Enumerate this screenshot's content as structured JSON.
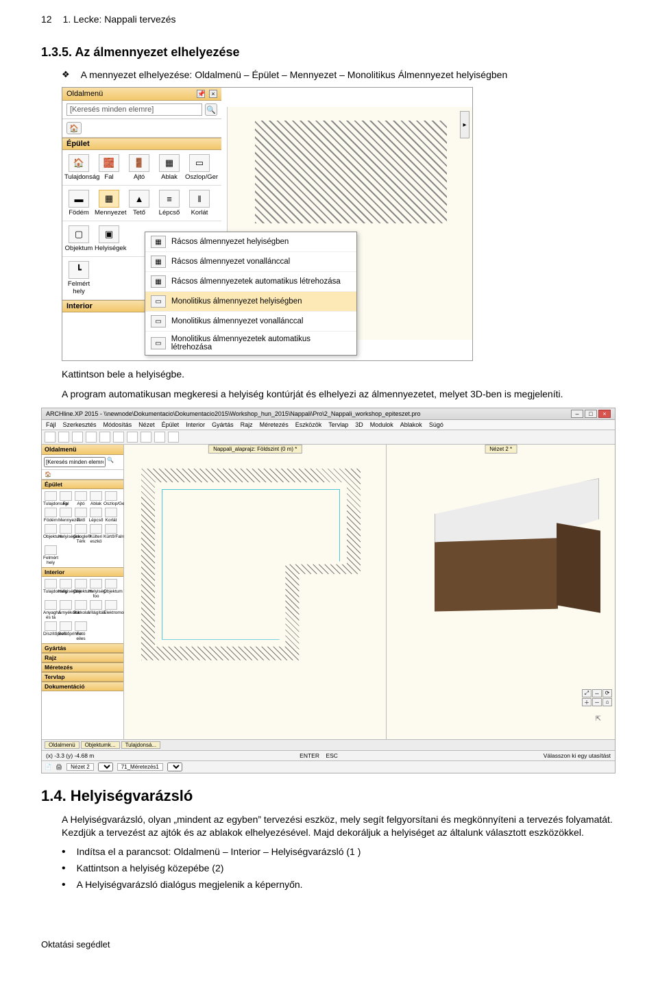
{
  "page": {
    "number": "12",
    "header_title": "1. Lecke: Nappali tervezés"
  },
  "sec135": {
    "heading": "1.3.5.  Az álmennyezet elhelyezése",
    "bullet1": "A mennyezet elhelyezése: Oldalmenü – Épület – Mennyezet – Monolitikus Álmennyezet helyiségben",
    "after_shot_line1": "Kattintson bele a helyiségbe.",
    "after_shot_line2": "A program automatikusan megkeresi a helyiség kontúrját és elhelyezi az álmennyezetet, melyet 3D-ben is megjeleníti."
  },
  "shot1": {
    "title": "Oldalmenü",
    "search_placeholder": "[Keresés minden elemre]",
    "cat_epulet": "Épület",
    "row1": [
      "Tulajdonság",
      "Fal",
      "Ajtó",
      "Ablak",
      "Oszlop/Ger"
    ],
    "row2": [
      "Födém",
      "Mennyezet",
      "Tető",
      "Lépcső",
      "Korlát"
    ],
    "row3": [
      "Objektum",
      "Helyiségek",
      "",
      "",
      ""
    ],
    "row4": [
      "Felmért hely",
      "",
      "",
      "",
      ""
    ],
    "cat_interior": "Interior",
    "flyout": [
      "Rácsos álmennyezet helyiségben",
      "Rácsos álmennyezet vonallánccal",
      "Rácsos álmennyezetek automatikus létrehozása",
      "Monolitikus álmennyezet helyiségben",
      "Monolitikus álmennyezet vonallánccal",
      "Monolitikus álmennyezetek automatikus létrehozása"
    ],
    "flyout_hover_index": 3
  },
  "shot2": {
    "window_title": "ARCHline.XP 2015 - \\\\newnode\\Dokumentacio\\Dokumentacio2015\\Workshop_hun_2015\\Nappali\\Pro\\2_Nappali_workshop_epiteszet.pro",
    "menubar": [
      "Fájl",
      "Szerkesztés",
      "Módosítás",
      "Nézet",
      "Épület",
      "Interior",
      "Gyártás",
      "Rajz",
      "Méretezés",
      "Eszközök",
      "Tervlap",
      "3D",
      "Modulok",
      "Ablakok",
      "Súgó"
    ],
    "sidebar_title": "Oldalmenü",
    "sidebar_search": "[Keresés minden elemre]",
    "sb_cats": {
      "epulet": "Épület",
      "epulet_items": [
        "Tulajdonság",
        "Fal",
        "Ajtó",
        "Ablak",
        "Oszlop/Ger",
        "Födém",
        "Mennyezet",
        "Tető",
        "Lépcső",
        "Korlát",
        "Objektum",
        "Helyiségek",
        "Google® Térk",
        "Külteri eszkö",
        "Kürtő/Falroh",
        "Felmért hely"
      ],
      "interior": "Interior",
      "interior_items": [
        "Tulajdonság",
        "Helyiségvar",
        "Objektum",
        "Helyiség foo",
        "Objektum",
        "Anyagha és tá",
        "Árnyékolók",
        "Burkolat",
        "Világítás",
        "Elektromos",
        "Díszítőprofil",
        "Belsőprihoz",
        "Fotó eiles"
      ],
      "gyartas": "Gyártás",
      "rajz": "Rajz",
      "meretezes": "Méretezés",
      "tervlap": "Tervlap",
      "dokumentacio": "Dokumentáció"
    },
    "view2d_title": "Nappali_alaprajz: Földszint (0 m) *",
    "view3d_title": "Nézet 2 *",
    "bottom_tabs": [
      "Oldalmenü",
      "Objektumk...",
      "Tulajdonsá..."
    ],
    "coord_text": "(x) -3.3   (y) -4.68 m",
    "enter_label": "ENTER",
    "esc_label": "ESC",
    "status_prompt": "Válasszon ki egy utasítást",
    "ruler_tab1": "Nézet 2",
    "ruler_tab2": "71_Méretezés1"
  },
  "sec14": {
    "heading": "1.4. Helyiségvarázsló",
    "para": "A Helyiségvarázsló, olyan „mindent az egyben” tervezési eszköz, mely segít felgyorsítani és megkönnyíteni a tervezés folyamatát. Kezdjük a tervezést az ajtók és az ablakok elhelyezésével. Majd dekoráljuk a helyiséget az általunk választott eszközökkel.",
    "b1": "Indítsa el a parancsot: Oldalmenü – Interior – Helyiségvarázsló (1 )",
    "b2": "Kattintson a helyiség közepébe (2)",
    "b3": "A Helyiségvarázsló dialógus megjelenik a képernyőn."
  },
  "footer": "Oktatási segédlet"
}
